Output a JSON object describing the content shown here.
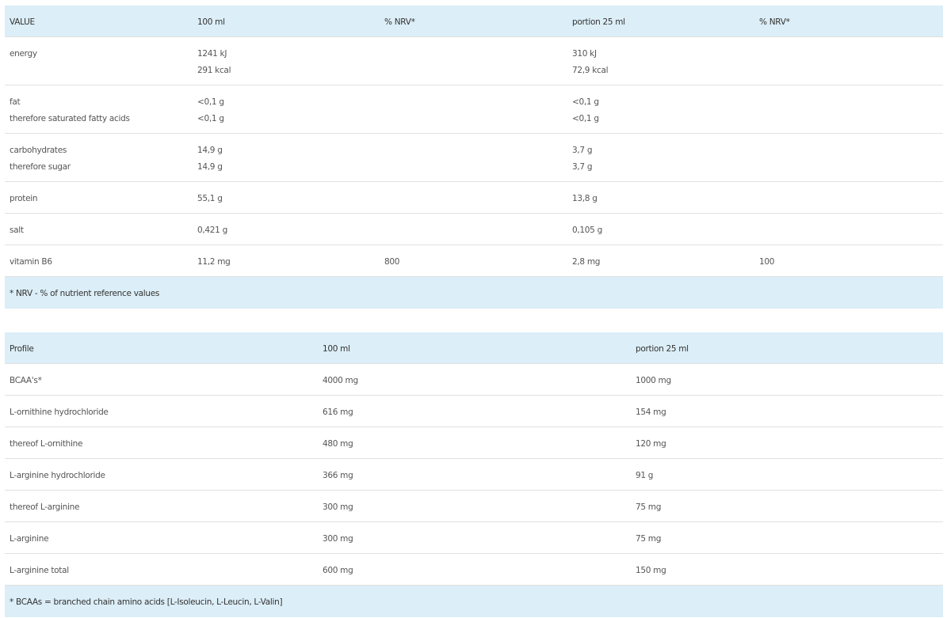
{
  "nutrition": {
    "headers": [
      "VALUE",
      "100 ml",
      "% NRV*",
      "portion 25 ml",
      "% NRV*"
    ],
    "rows": [
      {
        "label": [
          "energy",
          ""
        ],
        "per100": [
          "1241 kJ",
          "291 kcal"
        ],
        "nrv100": "",
        "portion": [
          "310 kJ",
          "72,9 kcal"
        ],
        "nrvPortion": ""
      },
      {
        "label": [
          "fat",
          "therefore saturated fatty acids"
        ],
        "per100": [
          "<0,1 g",
          "<0,1 g"
        ],
        "nrv100": "",
        "portion": [
          "<0,1 g",
          "<0,1 g"
        ],
        "nrvPortion": ""
      },
      {
        "label": [
          "carbohydrates",
          "therefore sugar"
        ],
        "per100": [
          "14,9 g",
          "14,9 g"
        ],
        "nrv100": "",
        "portion": [
          "3,7 g",
          "3,7 g"
        ],
        "nrvPortion": ""
      },
      {
        "label": [
          "protein"
        ],
        "per100": [
          "55,1 g"
        ],
        "nrv100": "",
        "portion": [
          "13,8 g"
        ],
        "nrvPortion": ""
      },
      {
        "label": [
          "salt"
        ],
        "per100": [
          "0,421 g"
        ],
        "nrv100": "",
        "portion": [
          "0,105 g"
        ],
        "nrvPortion": ""
      },
      {
        "label": [
          "vitamin B6"
        ],
        "per100": [
          "11,2 mg"
        ],
        "nrv100": "800",
        "portion": [
          "2,8 mg"
        ],
        "nrvPortion": "100"
      }
    ],
    "footnote": "* NRV - % of nutrient reference values"
  },
  "profile": {
    "headers": [
      "Profile",
      "100 ml",
      "portion 25 ml"
    ],
    "rows": [
      [
        "BCAA's*",
        "4000 mg",
        "1000 mg"
      ],
      [
        "L-ornithine hydrochloride",
        "616 mg",
        "154 mg"
      ],
      [
        "thereof L-ornithine",
        "480 mg",
        "120 mg"
      ],
      [
        "L-arginine hydrochloride",
        "366 mg",
        "91 g"
      ],
      [
        "thereof L-arginine",
        "300 mg",
        "75 mg"
      ],
      [
        "L-arginine",
        "300 mg",
        "75 mg"
      ],
      [
        "L-arginine total",
        "600 mg",
        "150 mg"
      ]
    ],
    "footnote": "* BCAAs = branched chain amino acids [L-Isoleucin, L-Leucin, L-Valin]"
  }
}
